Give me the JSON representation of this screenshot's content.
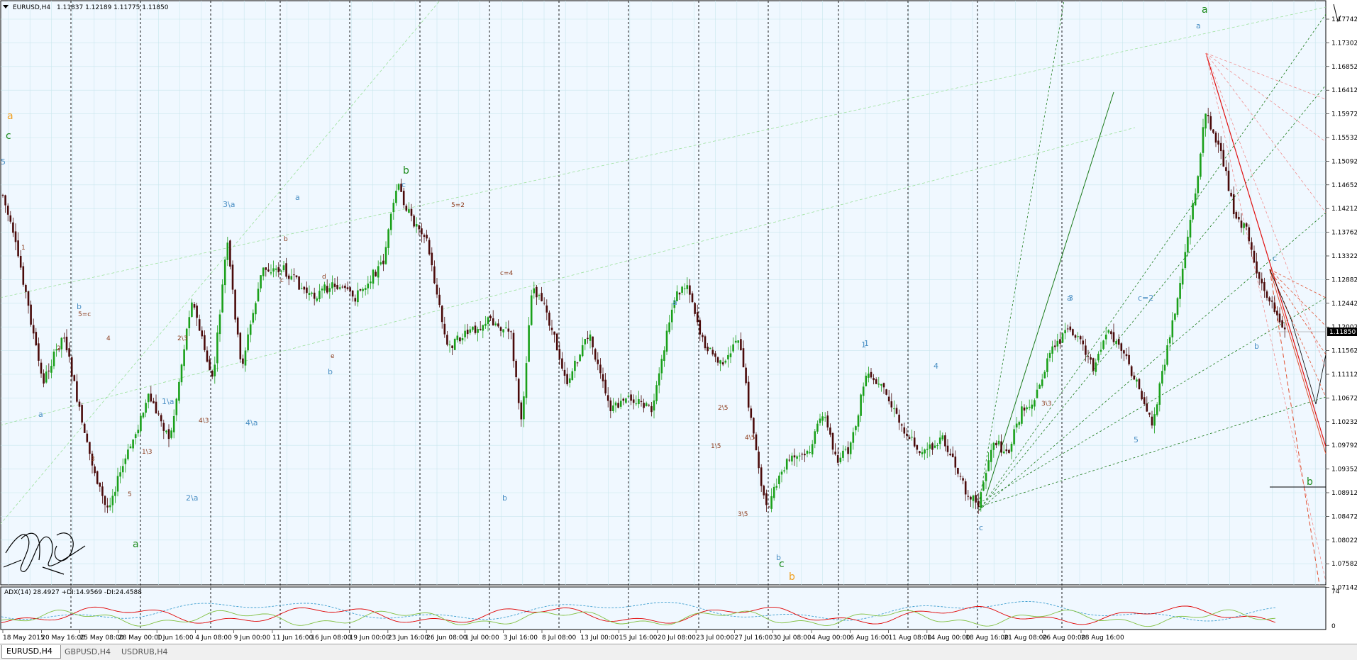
{
  "window": {
    "symbol_label": "EURUSD,H4",
    "ohlc": "1.11837 1.12189 1.11775 1.11850"
  },
  "indicator": {
    "label": "ADX(14) 28.4927 +DI:14.9569 -DI:24.4588",
    "scale_top": "74",
    "scale_bottom": "0"
  },
  "price_axis": {
    "labels": [
      "1.17742",
      "1.17302",
      "1.16852",
      "1.16412",
      "1.15972",
      "1.15532",
      "1.15092",
      "1.14652",
      "1.14212",
      "1.13762",
      "1.13322",
      "1.12882",
      "1.12442",
      "1.12002",
      "1.11562",
      "1.11112",
      "1.10672",
      "1.10232",
      "1.09792",
      "1.09352",
      "1.08912",
      "1.08472",
      "1.08022",
      "1.07582",
      "1.07142"
    ],
    "current_price": "1.11850"
  },
  "time_axis": {
    "labels": [
      "18 May 2015",
      "20 May 16:00",
      "25 May 08:00",
      "28 May 00:00",
      "1 Jun 16:00",
      "4 Jun 08:00",
      "9 Jun 00:00",
      "11 Jun 16:00",
      "16 Jun 08:00",
      "19 Jun 00:00",
      "23 Jun 16:00",
      "26 Jun 08:00",
      "1 Jul 00:00",
      "3 Jul 16:00",
      "8 Jul 08:00",
      "13 Jul 00:00",
      "15 Jul 16:00",
      "20 Jul 08:00",
      "23 Jul 00:00",
      "27 Jul 16:00",
      "30 Jul 08:00",
      "4 Aug 00:00",
      "6 Aug 16:00",
      "11 Aug 08:00",
      "14 Aug 00:00",
      "18 Aug 16:00",
      "21 Aug 08:00",
      "26 Aug 00:00",
      "28 Aug 16:00"
    ]
  },
  "tabs": [
    {
      "label": "EURUSD,H4",
      "active": true
    },
    {
      "label": "GBPUSD,H4",
      "active": false
    },
    {
      "label": "USDRUB,H4",
      "active": false
    }
  ],
  "wave_labels": {
    "green_big": [
      "a",
      "c",
      "b",
      "c",
      "a",
      "b"
    ],
    "orange_big": [
      "a",
      "b"
    ],
    "blue": [
      "5",
      "a",
      "b",
      "1\\a",
      "2\\a",
      "3\\a",
      "4\\a",
      "a",
      "b",
      "c",
      "b",
      "a",
      "b",
      "1",
      "c",
      "1",
      "a",
      "c=2",
      "3",
      "4",
      "5",
      "a",
      "b",
      "c"
    ],
    "brown": [
      "1",
      "2",
      "3",
      "4",
      "5",
      "b",
      "c",
      "d",
      "e",
      "5=c",
      "c=4",
      "1\\3",
      "2\\3",
      "3\\3",
      "4\\3",
      "3\\5",
      "4\\5",
      "1\\5",
      "2\\5",
      "5=2"
    ]
  },
  "colors": {
    "background": "#f0f8ff",
    "grid": "#c8e6ee",
    "bull": "#1aa01a",
    "bear": "#4a0a0a",
    "wave_green": "#1a8a1a",
    "wave_blue": "#4a8fc4",
    "wave_brown": "#8b3a1a",
    "wave_orange": "#f0a020",
    "adx_red": "#e00000",
    "adx_green": "#80c040",
    "adx_blue": "#40a0d0"
  }
}
